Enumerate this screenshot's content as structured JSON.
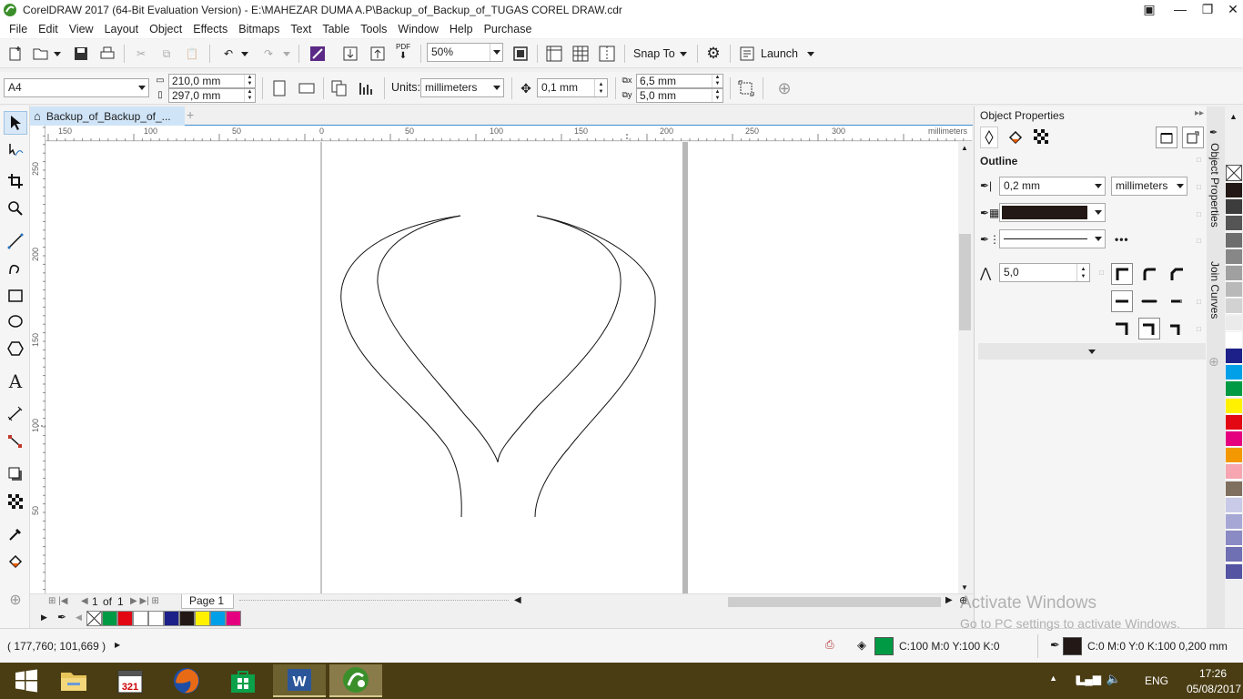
{
  "window": {
    "title": "CorelDRAW 2017 (64-Bit Evaluation Version) - E:\\MAHEZAR DUMA A.P\\Backup_of_Backup_of_TUGAS COREL DRAW.cdr",
    "controls": [
      "minimize",
      "restore",
      "close"
    ]
  },
  "menubar": [
    "File",
    "Edit",
    "View",
    "Layout",
    "Object",
    "Effects",
    "Bitmaps",
    "Text",
    "Table",
    "Tools",
    "Window",
    "Help",
    "Purchase"
  ],
  "standard_toolbar": {
    "zoom": "50%",
    "snap_to": "Snap To",
    "launch": "Launch",
    "pdf": "PDF"
  },
  "property_bar": {
    "page_size": "A4",
    "width": "210,0 mm",
    "height": "297,0 mm",
    "units_label": "Units:",
    "units": "millimeters",
    "nudge": "0,1 mm",
    "dup_x": "6,5 mm",
    "dup_y": "5,0 mm"
  },
  "document_tab": {
    "label": "Backup_of_Backup_of_..."
  },
  "ruler": {
    "h_labels": [
      "150",
      "100",
      "50",
      "0",
      "50",
      "100",
      "150",
      "200",
      "250",
      "300"
    ],
    "h_unit": "millimeters",
    "v_labels": [
      "250",
      "200",
      "150",
      "100",
      "50"
    ]
  },
  "page_nav": {
    "current": "1",
    "of_label": "of",
    "total": "1",
    "page_tab": "Page 1"
  },
  "docker": {
    "title": "Object Properties",
    "section": "Outline",
    "outline_width": "0,2 mm",
    "outline_units": "millimeters",
    "outline_color": "#231815",
    "miter_limit": "5,0",
    "vertical_tabs": [
      "Object Properties",
      "Join Curves"
    ]
  },
  "document_palette": [
    "#009a44",
    "#e30613",
    "#ffffff",
    "#ffffff",
    "#1d2088",
    "#231815",
    "#fff100",
    "#00a0e9",
    "#e4007f"
  ],
  "color_palette": [
    "#231815",
    "#3c3c3c",
    "#555555",
    "#6e6e6e",
    "#878787",
    "#a0a0a0",
    "#b9b9b9",
    "#d2d2d2",
    "#ebebeb",
    "#ffffff",
    "#1d2088",
    "#00a0e9",
    "#009a44",
    "#fff100",
    "#e30613",
    "#e4007f",
    "#f39800",
    "#f6a5b1",
    "#7f6f5f",
    "#c9c9e8",
    "#a7a7d6",
    "#8a8ac4",
    "#6f6fb3",
    "#5454a2"
  ],
  "statusbar": {
    "cursor_pos": "( 177,760; 101,669 )",
    "fill_color": "#009a44",
    "fill_text": "C:100 M:0 Y:100 K:0",
    "outline_color": "#231815",
    "outline_text": "C:0 M:0 Y:0 K:100  0,200 mm"
  },
  "watermark": {
    "line1": "Activate Windows",
    "line2": "Go to PC settings to activate Windows."
  },
  "taskbar": {
    "apps": [
      "start",
      "file-explorer",
      "calendar-321",
      "firefox",
      "store",
      "word",
      "coreldraw"
    ],
    "language": "ENG",
    "time": "17:26",
    "date": "05/08/2017"
  }
}
